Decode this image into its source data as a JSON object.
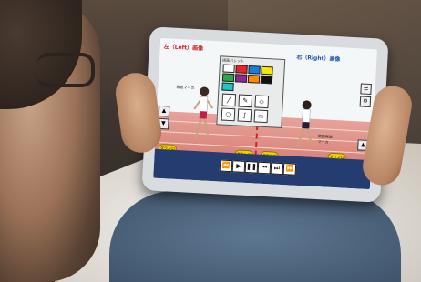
{
  "app": {
    "left_title": "左（Left）画像",
    "right_title": "右（Right）画像",
    "left_marker_text": "再送マーカ",
    "right_marker_text": "関節再送\nマーカ",
    "yellow_label_left": "ダウンロード",
    "yellow_label_mid1": "ダウンロード",
    "yellow_label_mid2": "ダウンロード",
    "yellow_label_right": "ダウンロード",
    "palette_title": "描画パレット"
  },
  "controls": {
    "rewind": "⏪",
    "play": "▶",
    "pause": "❚❚",
    "prev": "⏮",
    "next": "⏭",
    "fast_forward": "⏩"
  },
  "palette_colors": [
    "#ffffff",
    "#e8232a",
    "#1c7cd8",
    "#f7e600",
    "#2aa84a",
    "#8e2a8e",
    "#ff8a00",
    "#111111",
    "#21c3c3"
  ],
  "icons": [
    "draw-line-icon",
    "pencil-icon",
    "eraser-icon",
    "circle-icon",
    "curve-icon",
    "rectangle-icon"
  ]
}
